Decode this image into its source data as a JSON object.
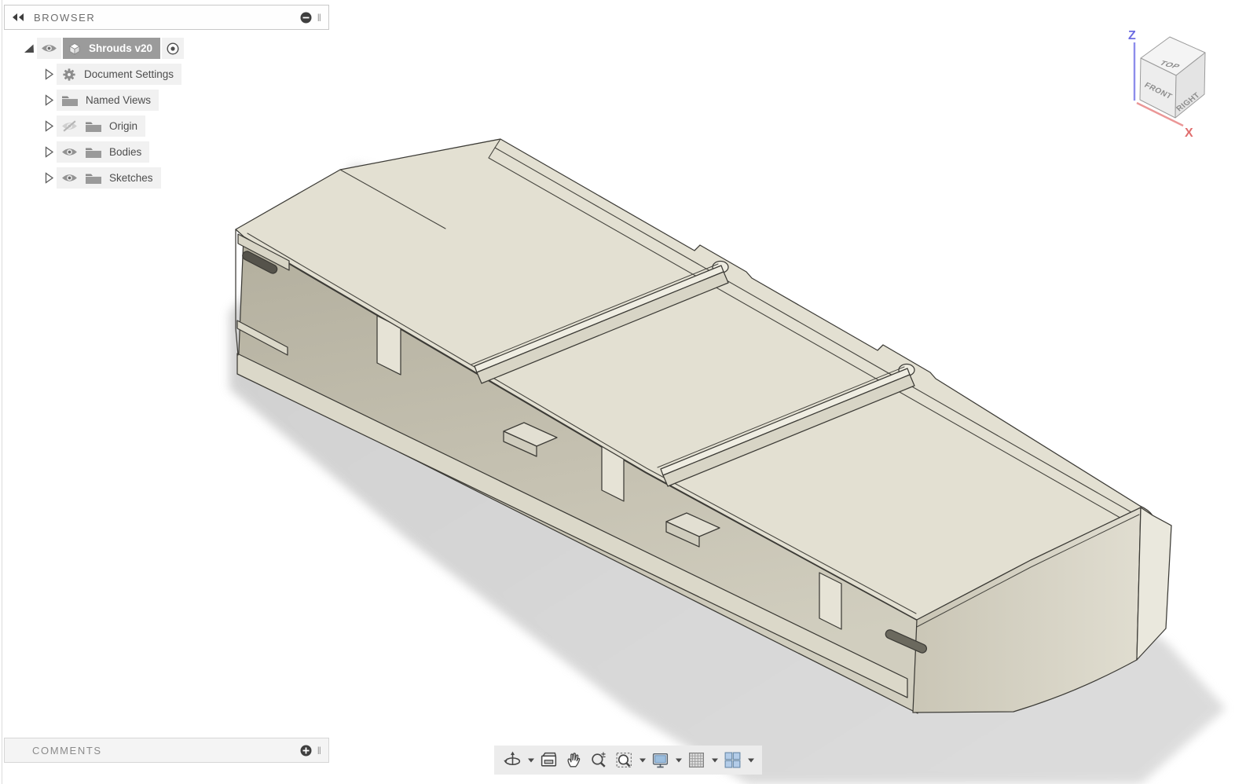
{
  "browser_panel": {
    "title": "BROWSER",
    "collapse_icon": "collapse-panel-icon",
    "remove_icon": "minus-circle-icon",
    "tree": [
      {
        "label": "Shrouds v20",
        "icon": "component-cube-icon",
        "expander": "expanded",
        "visibility": "visible",
        "selected": true,
        "trailing_icon": "activate-radio-icon"
      },
      {
        "label": "Document Settings",
        "icon": "gear-icon",
        "expander": "collapsed",
        "visibility": "none",
        "selected": false
      },
      {
        "label": "Named Views",
        "icon": "folder-icon",
        "expander": "collapsed",
        "visibility": "none",
        "selected": false
      },
      {
        "label": "Origin",
        "icon": "folder-icon",
        "expander": "collapsed",
        "visibility": "hidden",
        "selected": false
      },
      {
        "label": "Bodies",
        "icon": "folder-icon",
        "expander": "collapsed",
        "visibility": "visible",
        "selected": false
      },
      {
        "label": "Sketches",
        "icon": "folder-icon",
        "expander": "collapsed",
        "visibility": "visible",
        "selected": false
      }
    ]
  },
  "comments_panel": {
    "title": "COMMENTS",
    "add_icon": "plus-circle-icon"
  },
  "viewcube": {
    "top": "TOP",
    "front": "FRONT",
    "right": "RIGHT",
    "axis_z": "Z",
    "axis_x": "X",
    "colors": {
      "z_axis": "#7373e6",
      "x_axis": "#e58080"
    }
  },
  "nav_toolbar": {
    "buttons": [
      {
        "name": "orbit",
        "icon": "orbit-icon",
        "has_dropdown": true
      },
      {
        "name": "look-at",
        "icon": "look-at-icon",
        "has_dropdown": false
      },
      {
        "name": "pan",
        "icon": "pan-hand-icon",
        "has_dropdown": false
      },
      {
        "name": "zoom",
        "icon": "zoom-icon",
        "has_dropdown": false
      },
      {
        "name": "fit",
        "icon": "zoom-fit-icon",
        "has_dropdown": true
      },
      {
        "name": "display-settings",
        "icon": "display-settings-icon",
        "has_dropdown": true
      },
      {
        "name": "grid-and-snaps",
        "icon": "grid-icon",
        "has_dropdown": true
      },
      {
        "name": "viewports",
        "icon": "viewports-icon",
        "has_dropdown": true
      }
    ]
  },
  "model": {
    "name": "Shrouds v20",
    "body_color": "#e3e0d2",
    "wall_color": "#d2cfbf",
    "interior_color": "#bcb8a7",
    "edge_color": "#3c3b36",
    "shadow_color": "#d1d1d1",
    "background": "#ffffff"
  }
}
